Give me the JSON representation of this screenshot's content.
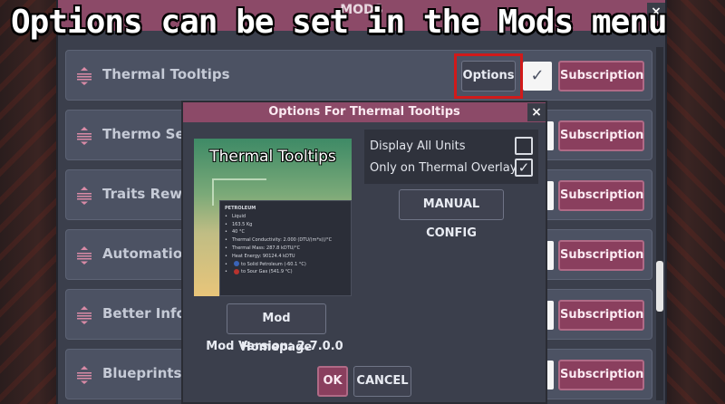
{
  "caption": "Options can be set in the Mods menu",
  "mods_window": {
    "title": "MODS",
    "close_label": "×"
  },
  "mods": [
    {
      "name": "Thermal Tooltips",
      "subscription_label": "Subscription",
      "options_label": "Options",
      "enabled": true,
      "enabled_mark": "✓"
    },
    {
      "name": "Thermo Sensor",
      "subscription_label": "Subscription"
    },
    {
      "name": "Traits Rework",
      "subscription_label": "Subscription"
    },
    {
      "name": "Automation Ex",
      "subscription_label": "Subscription"
    },
    {
      "name": "Better Info Ca",
      "subscription_label": "Subscription"
    },
    {
      "name": "Blueprints",
      "subscription_label": "Subscription"
    }
  ],
  "dialog": {
    "title": "Options For Thermal Tooltips",
    "close_label": "×",
    "preview": {
      "title": "Thermal Tooltips",
      "info_heading": "PETROLEUM",
      "info_lines": [
        "Liquid",
        "163.5 Kg",
        "40 °C",
        "Thermal Conductivity: 2.000 (DTU/(m*s))/°C",
        "Thermal Mass: 287.8 kDTU/°C",
        "Heat Energy: 90124.4 kDTU"
      ],
      "transition_1": "to Solid Petroleum (-60.1 °C)",
      "transition_2": "to Sour Gas (541.9 °C)"
    },
    "settings": [
      {
        "label": "Display All Units",
        "checked": false,
        "mark": ""
      },
      {
        "label": "Only on Thermal Overlay",
        "checked": true,
        "mark": "✓"
      }
    ],
    "manual_config_label": "MANUAL CONFIG",
    "homepage_label": "Mod Homepage",
    "version_label": "Mod Version: 2.7.0.0",
    "ok_label": "OK",
    "cancel_label": "CANCEL"
  },
  "colors": {
    "accent": "#8a3f5e",
    "titlebar": "#8c4a68",
    "highlight": "#d11a1a"
  }
}
